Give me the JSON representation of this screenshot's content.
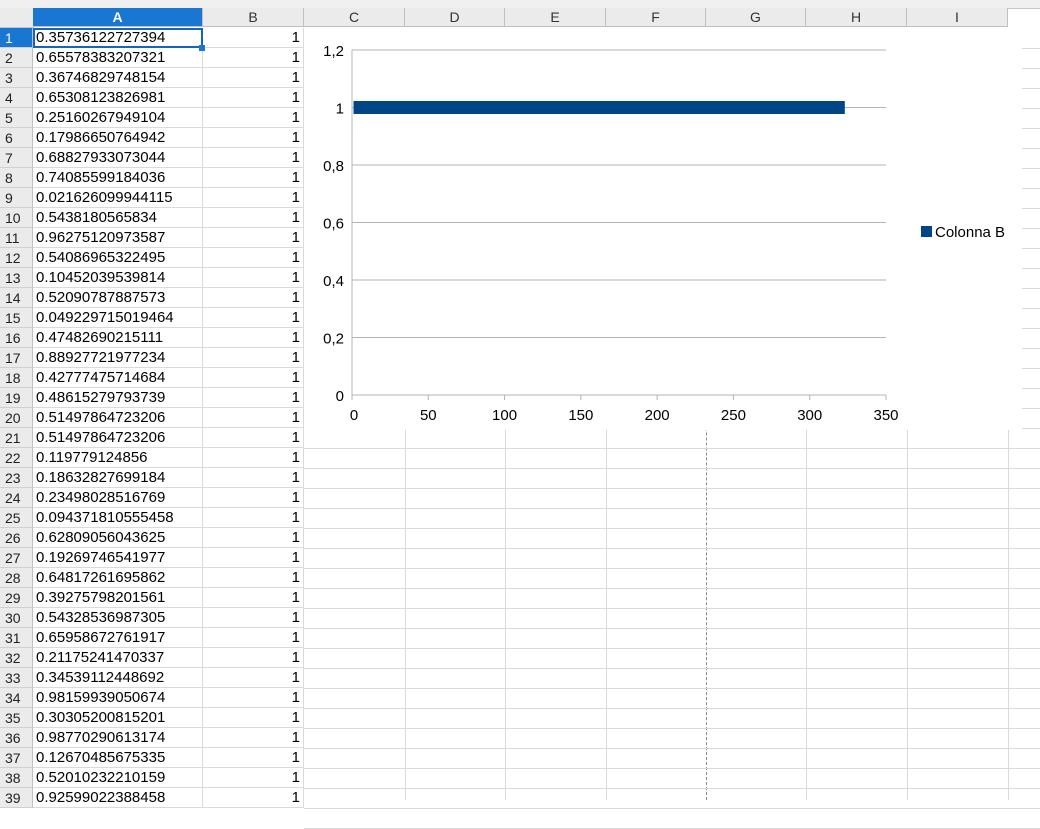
{
  "columns": [
    "A",
    "B",
    "C",
    "D",
    "E",
    "F",
    "G",
    "H",
    "I"
  ],
  "selected_column": "A",
  "active_row": 1,
  "rows": [
    {
      "n": "1",
      "a": "0.35736122727394",
      "b": "1"
    },
    {
      "n": "2",
      "a": "0.65578383207321",
      "b": "1"
    },
    {
      "n": "3",
      "a": "0.36746829748154",
      "b": "1"
    },
    {
      "n": "4",
      "a": "0.65308123826981",
      "b": "1"
    },
    {
      "n": "5",
      "a": "0.25160267949104",
      "b": "1"
    },
    {
      "n": "6",
      "a": "0.17986650764942",
      "b": "1"
    },
    {
      "n": "7",
      "a": "0.68827933073044",
      "b": "1"
    },
    {
      "n": "8",
      "a": "0.74085599184036",
      "b": "1"
    },
    {
      "n": "9",
      "a": "0.021626099944115",
      "b": "1"
    },
    {
      "n": "10",
      "a": "0.5438180565834",
      "b": "1"
    },
    {
      "n": "11",
      "a": "0.96275120973587",
      "b": "1"
    },
    {
      "n": "12",
      "a": "0.54086965322495",
      "b": "1"
    },
    {
      "n": "13",
      "a": "0.10452039539814",
      "b": "1"
    },
    {
      "n": "14",
      "a": "0.52090787887573",
      "b": "1"
    },
    {
      "n": "15",
      "a": "0.049229715019464",
      "b": "1"
    },
    {
      "n": "16",
      "a": "0.47482690215111",
      "b": "1"
    },
    {
      "n": "17",
      "a": "0.88927721977234",
      "b": "1"
    },
    {
      "n": "18",
      "a": "0.42777475714684",
      "b": "1"
    },
    {
      "n": "19",
      "a": "0.48615279793739",
      "b": "1"
    },
    {
      "n": "20",
      "a": "0.51497864723206",
      "b": "1"
    },
    {
      "n": "21",
      "a": "0.51497864723206",
      "b": "1"
    },
    {
      "n": "22",
      "a": "0.119779124856",
      "b": "1"
    },
    {
      "n": "23",
      "a": "0.18632827699184",
      "b": "1"
    },
    {
      "n": "24",
      "a": "0.23498028516769",
      "b": "1"
    },
    {
      "n": "25",
      "a": "0.094371810555458",
      "b": "1"
    },
    {
      "n": "26",
      "a": "0.62809056043625",
      "b": "1"
    },
    {
      "n": "27",
      "a": "0.19269746541977",
      "b": "1"
    },
    {
      "n": "28",
      "a": "0.64817261695862",
      "b": "1"
    },
    {
      "n": "29",
      "a": "0.39275798201561",
      "b": "1"
    },
    {
      "n": "30",
      "a": "0.54328536987305",
      "b": "1"
    },
    {
      "n": "31",
      "a": "0.65958672761917",
      "b": "1"
    },
    {
      "n": "32",
      "a": "0.21175241470337",
      "b": "1"
    },
    {
      "n": "33",
      "a": "0.34539112448692",
      "b": "1"
    },
    {
      "n": "34",
      "a": "0.98159939050674",
      "b": "1"
    },
    {
      "n": "35",
      "a": "0.30305200815201",
      "b": "1"
    },
    {
      "n": "36",
      "a": "0.98770290613174",
      "b": "1"
    },
    {
      "n": "37",
      "a": "0.12670485675335",
      "b": "1"
    },
    {
      "n": "38",
      "a": "0.52010232210159",
      "b": "1"
    },
    {
      "n": "39",
      "a": "0.92599022388458",
      "b": "1"
    }
  ],
  "chart_data": {
    "type": "line",
    "series": [
      {
        "name": "Colonna B",
        "x": [
          1,
          323
        ],
        "y": [
          1,
          1
        ],
        "color": "#004586"
      }
    ],
    "xlim": [
      0,
      350
    ],
    "ylim": [
      0,
      1.2
    ],
    "x_ticks": [
      "0",
      "50",
      "100",
      "150",
      "200",
      "250",
      "300",
      "350"
    ],
    "y_ticks": [
      "0",
      "0,2",
      "0,4",
      "0,6",
      "0,8",
      "1",
      "1,2"
    ],
    "grid": "horizontal",
    "legend": "right",
    "title": "",
    "xlabel": "",
    "ylabel": ""
  }
}
